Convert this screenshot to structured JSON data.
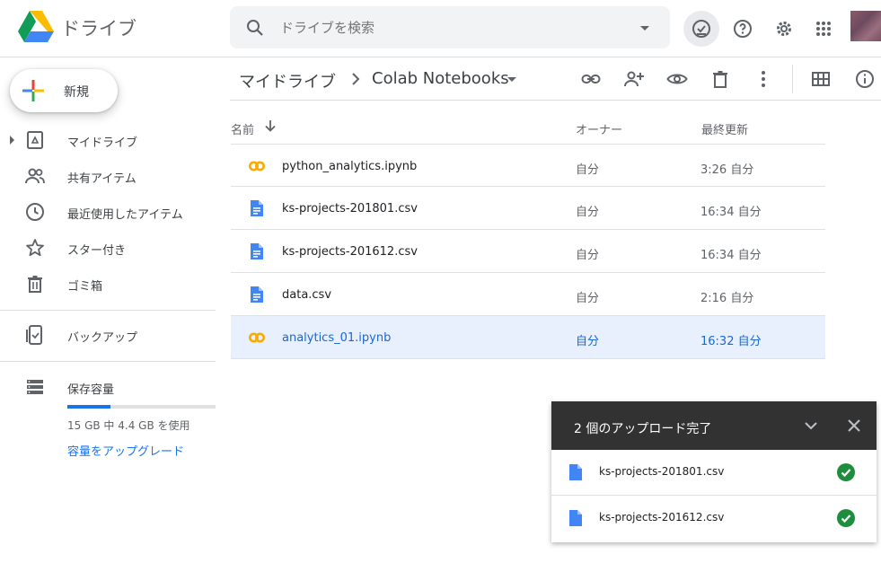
{
  "header": {
    "app_name": "ドライブ",
    "search_placeholder": "ドライブを検索"
  },
  "sidebar": {
    "new_label": "新規",
    "items": [
      {
        "label": "マイドライブ",
        "icon": "my-drive-icon"
      },
      {
        "label": "共有アイテム",
        "icon": "shared-people-icon"
      },
      {
        "label": "最近使用したアイテム",
        "icon": "clock-icon"
      },
      {
        "label": "スター付き",
        "icon": "star-icon"
      },
      {
        "label": "ゴミ箱",
        "icon": "trash-icon"
      }
    ],
    "backup": {
      "label": "バックアップ",
      "icon": "backup-device-icon"
    },
    "storage": {
      "label": "保存容量",
      "usage_text": "15 GB 中 4.4 GB を使用",
      "used_fraction": 0.29,
      "upgrade_label": "容量をアップグレード"
    }
  },
  "breadcrumb": {
    "root": "マイドライブ",
    "current": "Colab Notebooks"
  },
  "table": {
    "headers": {
      "name": "名前",
      "owner": "オーナー",
      "modified": "最終更新"
    },
    "rows": [
      {
        "name": "python_analytics.ipynb",
        "type": "colab",
        "owner": "自分",
        "modified": "3:26 自分",
        "selected": false
      },
      {
        "name": "ks-projects-201801.csv",
        "type": "doc",
        "owner": "自分",
        "modified": "16:34 自分",
        "selected": false
      },
      {
        "name": "ks-projects-201612.csv",
        "type": "doc",
        "owner": "自分",
        "modified": "16:34 自分",
        "selected": false
      },
      {
        "name": "data.csv",
        "type": "doc",
        "owner": "自分",
        "modified": "2:16 自分",
        "selected": false
      },
      {
        "name": "analytics_01.ipynb",
        "type": "colab",
        "owner": "自分",
        "modified": "16:32 自分",
        "selected": true
      }
    ]
  },
  "upload": {
    "title": "2 個のアップロード完了",
    "items": [
      {
        "name": "ks-projects-201801.csv",
        "status": "complete"
      },
      {
        "name": "ks-projects-201612.csv",
        "status": "complete"
      }
    ]
  },
  "colors": {
    "accent": "#1a73e8",
    "selected_row": "#e8f0fe",
    "success": "#1e8e3e",
    "colab": "#f9ab00",
    "doc_icon": "#4285f4"
  }
}
